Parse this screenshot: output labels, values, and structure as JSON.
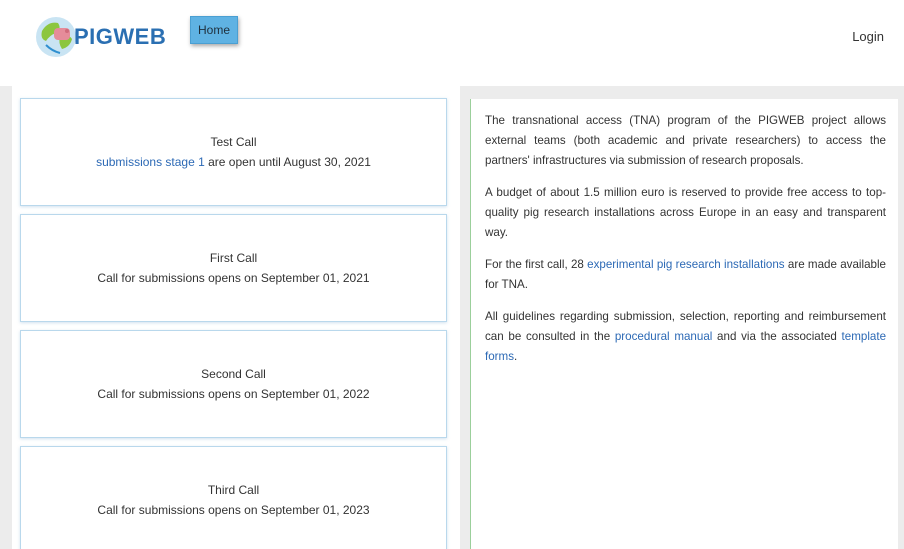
{
  "header": {
    "logo_text": "PIGWEB",
    "home_label": "Home",
    "login_label": "Login"
  },
  "calls": [
    {
      "title": "Test Call",
      "link_text": "submissions stage 1",
      "text": " are open until August 30, 2021"
    },
    {
      "title": "First Call",
      "text": "Call for submissions opens on September 01, 2021"
    },
    {
      "title": "Second Call",
      "text": "Call for submissions opens on September 01, 2022"
    },
    {
      "title": "Third Call",
      "text": "Call for submissions opens on September 01, 2023"
    }
  ],
  "info": {
    "p1": "The transnational access (TNA) program of the PIGWEB project allows external teams (both academic and private researchers) to access the partners' infrastructures via submission of research proposals.",
    "p2": "A budget of about 1.5 million euro is reserved to provide free access to top-quality pig research installations across Europe in an easy and transparent way.",
    "p3_before": "For the first call, 28 ",
    "p3_link": "experimental pig research installations",
    "p3_after": " are made available for TNA.",
    "p4_before": "All guidelines regarding submission, selection, reporting and reimbursement can be consulted in the ",
    "p4_link1": "procedural manual",
    "p4_middle": " and via the associated ",
    "p4_link2": "template forms",
    "p4_after": "."
  },
  "colors": {
    "link": "#2c69b5",
    "home_button": "#5fb2e3",
    "logo_text": "#2a6fb2",
    "card_border": "#b9d8ec",
    "divider": "#9bcf9b"
  },
  "icons": {
    "logo": "globe-logo-icon"
  }
}
